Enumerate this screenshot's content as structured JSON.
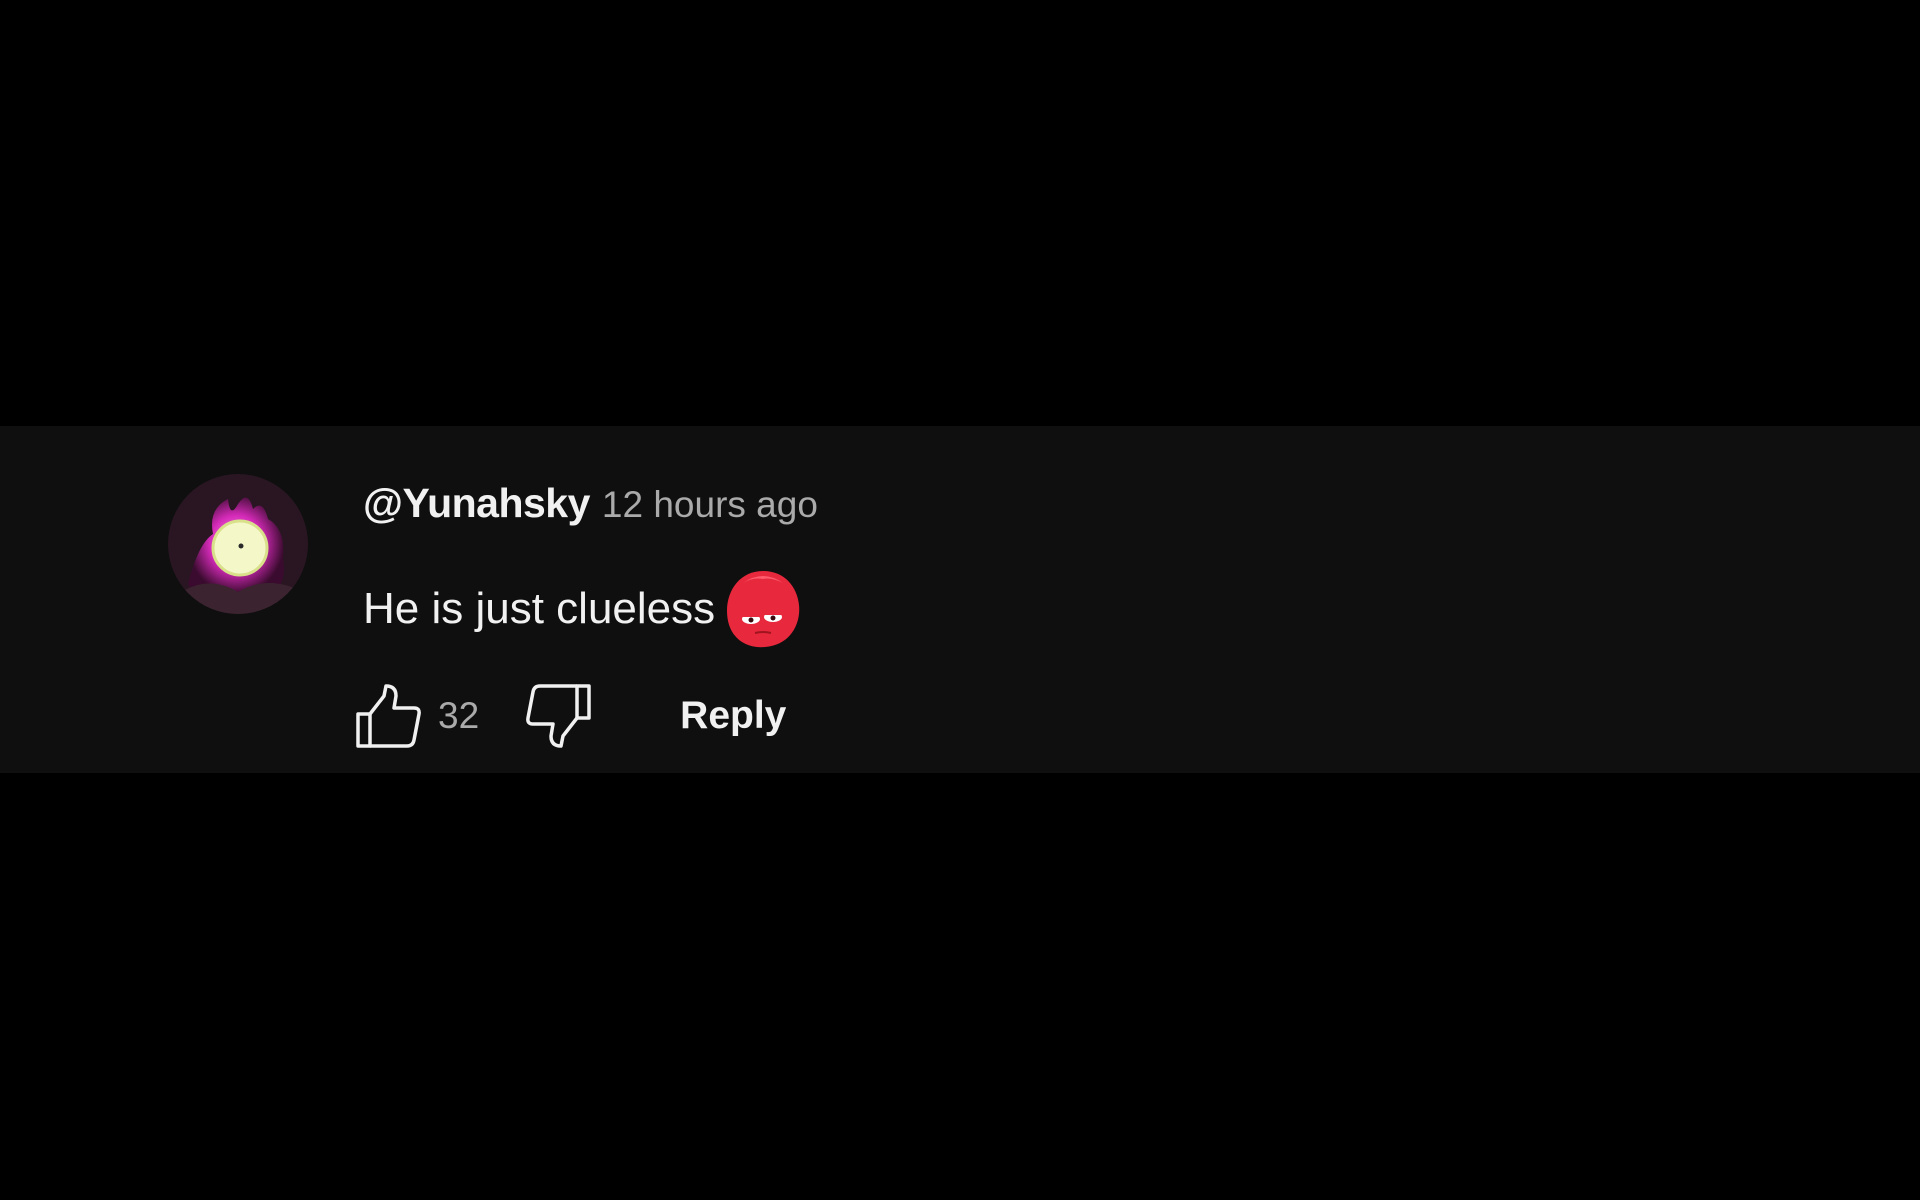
{
  "comment": {
    "author": "@Yunahsky",
    "timestamp": "12 hours ago",
    "text": "He is just clueless",
    "emoji": "clueless-face-emoji",
    "like_count": "32",
    "reply_label": "Reply"
  },
  "icons": {
    "like": "thumbs-up-icon",
    "dislike": "thumbs-down-icon"
  },
  "colors": {
    "page_background": "#000000",
    "strip_background": "#0f0f0f",
    "primary_text": "#f1f1f1",
    "secondary_text": "#aaaaaa",
    "avatar_accent": "#e040c8",
    "emoji_red": "#e8283c"
  }
}
